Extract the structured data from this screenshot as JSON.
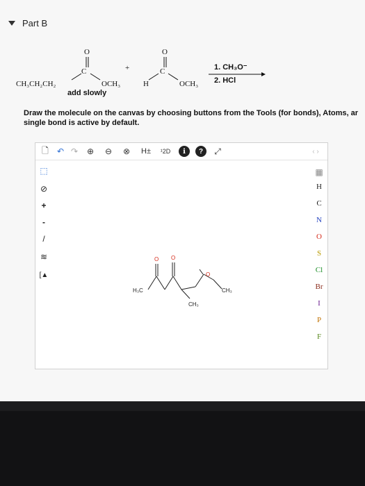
{
  "part": {
    "title": "Part B"
  },
  "reaction": {
    "reactant1_chain": "CH₃CH₂CH₂",
    "reactant1_och3": "OCH₃",
    "reactant1_carbon": "C",
    "reactant1_oxygen": "O",
    "plus": "+",
    "reactant2_h": "H",
    "reactant2_carbon": "C",
    "reactant2_oxygen": "O",
    "reactant2_och3": "OCH₃",
    "condition1": "1. CH₃O⁻",
    "condition2": "2. HCl",
    "add_slowly": "add slowly"
  },
  "instructions": {
    "line1": "Draw the molecule on the canvas by choosing buttons from the Tools (for bonds), Atoms, ar",
    "line2": "single bond is active by default."
  },
  "toolbar": {
    "new": "🗋",
    "undo": "↶",
    "redo": "↷",
    "zoom_in": "⊕",
    "zoom_out": "⊖",
    "reset": "⊗",
    "h_toggle": "H±",
    "two_d": "¹2D",
    "info": "ℹ",
    "help": "?",
    "expand": "⤢",
    "nav": "‹ ›"
  },
  "left_tools": {
    "select": "⬚",
    "eraser": "⊘",
    "plus_charge": "+",
    "minus_charge": "-",
    "bond": "/",
    "chain": "≋",
    "bracket": "[▲"
  },
  "atoms": {
    "periodic": "▦",
    "list": [
      "H",
      "C",
      "N",
      "O",
      "S",
      "Cl",
      "Br",
      "I",
      "P",
      "F"
    ],
    "colors": {
      "H": "#222222",
      "C": "#222222",
      "N": "#1f3fbf",
      "O": "#d42a1a",
      "S": "#b89a00",
      "Cl": "#1f8f2a",
      "Br": "#8a2a1a",
      "I": "#6a1f8f",
      "P": "#c07000",
      "F": "#5a8a1f"
    }
  },
  "molecule": {
    "label_h3c": "H₃C",
    "label_ch3_bottom": "CH₃",
    "label_ch3_right": "CH₃",
    "o1": "O",
    "o2": "O",
    "o3": "O"
  }
}
